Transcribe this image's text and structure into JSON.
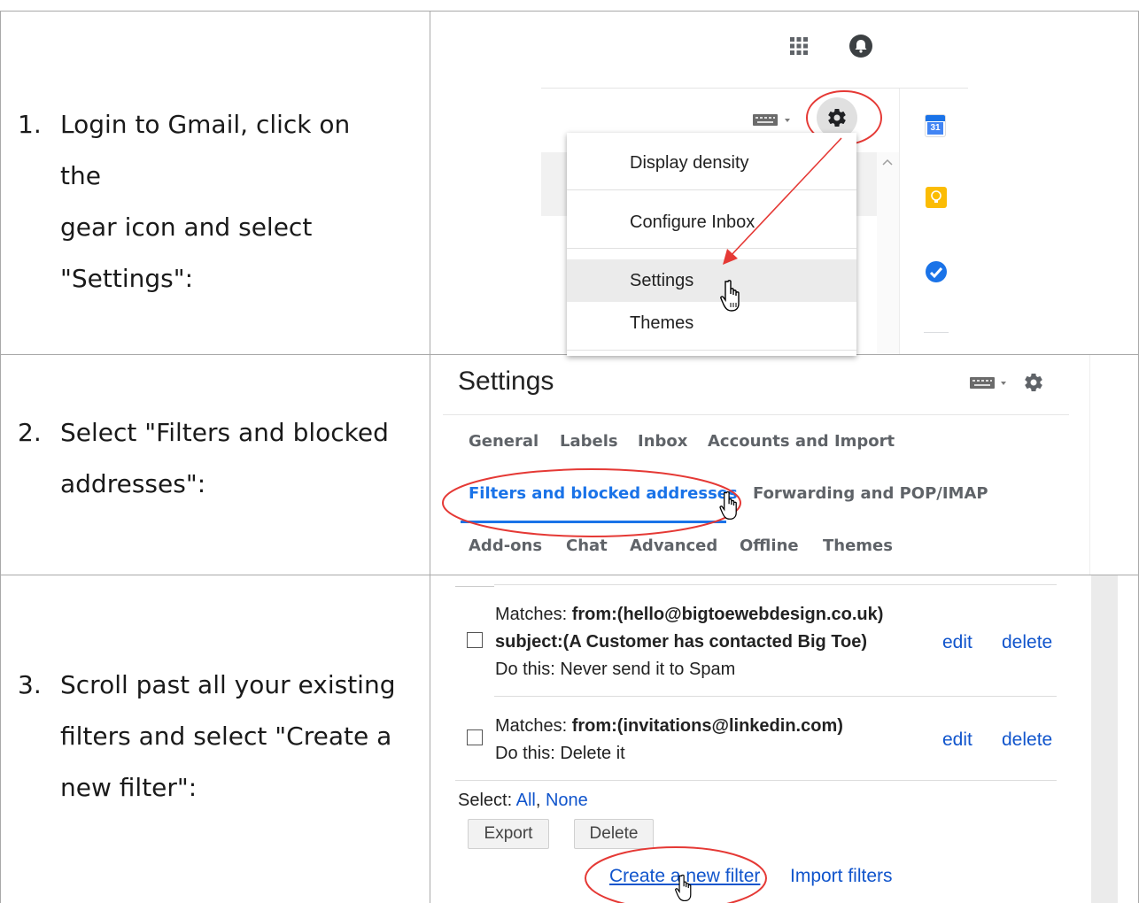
{
  "steps": [
    {
      "number": "1.",
      "lines": [
        "Login to Gmail, click on the",
        "gear icon and select",
        "\"Settings\":"
      ]
    },
    {
      "number": "2.",
      "lines": [
        "Select \"Filters and blocked",
        "addresses\":"
      ]
    },
    {
      "number": "3.",
      "lines": [
        "Scroll past all your existing",
        "filters and select \"Create a",
        "new filter\":"
      ]
    }
  ],
  "panel1": {
    "menu_items": [
      "Display density",
      "Configure Inbox",
      "Settings",
      "Themes"
    ],
    "calendar_day": "31"
  },
  "panel2": {
    "title": "Settings",
    "tabs_row1": [
      "General",
      "Labels",
      "Inbox",
      "Accounts and Import"
    ],
    "tabs_row2": [
      "Filters and blocked addresses",
      "Forwarding and POP/IMAP"
    ],
    "tabs_row3": [
      "Add-ons",
      "Chat",
      "Advanced",
      "Offline",
      "Themes"
    ]
  },
  "panel3": {
    "filter1": {
      "matches_label": "Matches: ",
      "matches_value": "from:(hello@bigtoewebdesign.co.uk)",
      "subject_value": "subject:(A Customer has contacted Big Toe)",
      "action": "Do this: Never send it to Spam"
    },
    "filter2": {
      "matches_label": "Matches: ",
      "matches_value": "from:(invitations@linkedin.com)",
      "action": "Do this: Delete it"
    },
    "edit_label": "edit",
    "delete_label": "delete",
    "select_label": "Select: ",
    "select_all": "All",
    "select_sep": ", ",
    "select_none": "None",
    "export_button": "Export",
    "delete_button": "Delete",
    "create_filter": "Create a new filter",
    "import_filters": "Import filters"
  },
  "colors": {
    "link": "#1155cc",
    "tab_active": "#1a73e8",
    "annotation": "#e53935"
  }
}
